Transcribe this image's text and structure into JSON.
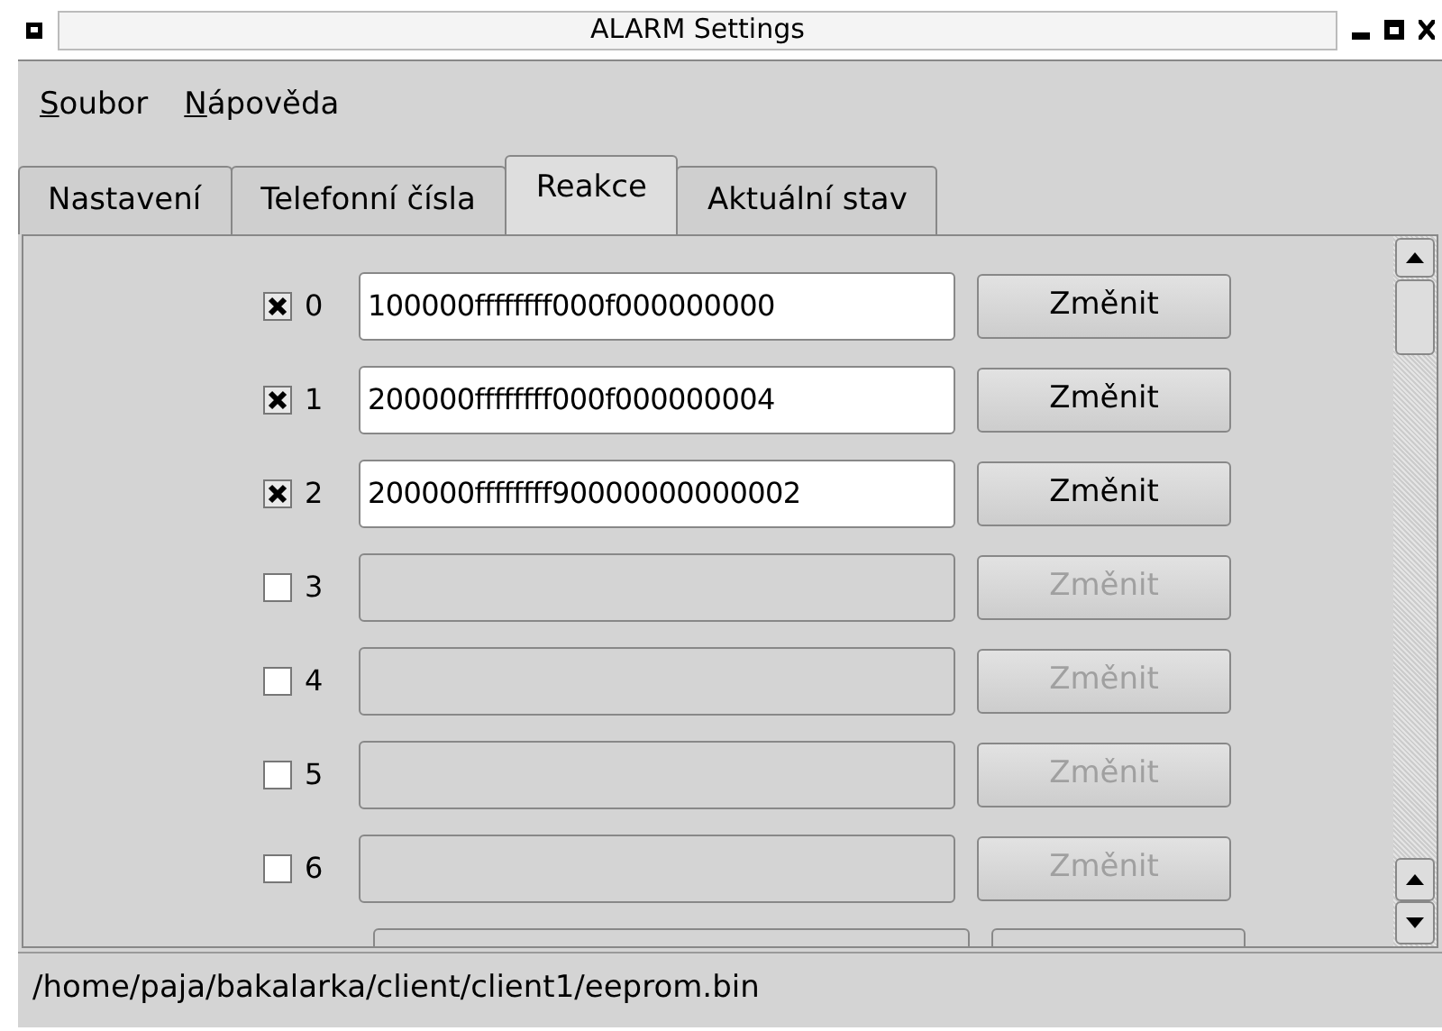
{
  "window": {
    "title": "ALARM Settings"
  },
  "menu": [
    {
      "label": "Soubor"
    },
    {
      "label": "Nápověda"
    }
  ],
  "tabs": [
    {
      "label": "Nastavení",
      "selected": false
    },
    {
      "label": "Telefonní čísla",
      "selected": false
    },
    {
      "label": "Reakce",
      "selected": true
    },
    {
      "label": "Aktuální stav",
      "selected": false
    }
  ],
  "rows": [
    {
      "index": "0",
      "checked": true,
      "value": "100000ffffffff000f000000000",
      "button": "Změnit",
      "disabled": false
    },
    {
      "index": "1",
      "checked": true,
      "value": "200000ffffffff000f000000004",
      "button": "Změnit",
      "disabled": false
    },
    {
      "index": "2",
      "checked": true,
      "value": "200000ffffffff90000000000002",
      "button": "Změnit",
      "disabled": false
    },
    {
      "index": "3",
      "checked": false,
      "button": "Změnit",
      "disabled": true
    },
    {
      "index": "4",
      "checked": false,
      "button": "Změnit",
      "disabled": true
    },
    {
      "index": "5",
      "checked": false,
      "button": "Změnit",
      "disabled": true
    },
    {
      "index": "6",
      "checked": false,
      "button": "Změnit",
      "disabled": true
    }
  ],
  "status_bar": "/home/paja/bakalarka/client/client1/eeprom.bin"
}
